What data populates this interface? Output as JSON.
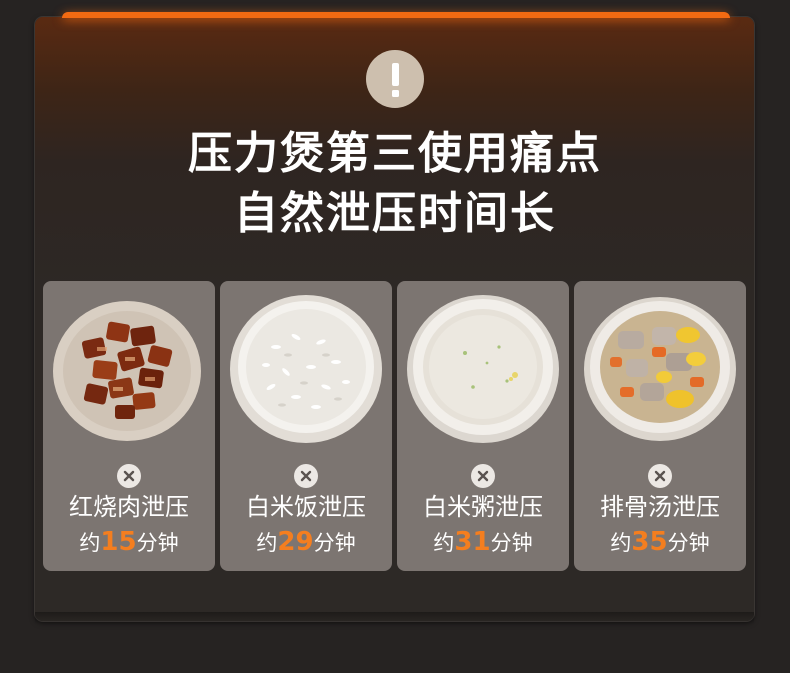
{
  "title": {
    "line1": "压力煲第三使用痛点",
    "line2": "自然泄压时间长"
  },
  "icons": {
    "header": "warning-icon",
    "card_badge": "close-icon"
  },
  "colors": {
    "accent": "#f26a12",
    "highlight_number": "#f47e1f",
    "card_bg": "#7c7571",
    "warning_circle": "#cdbfae"
  },
  "cards": [
    {
      "name": "红烧肉泄压",
      "prefix": "约",
      "minutes": "15",
      "suffix": "分钟"
    },
    {
      "name": "白米饭泄压",
      "prefix": "约",
      "minutes": "29",
      "suffix": "分钟"
    },
    {
      "name": "白米粥泄压",
      "prefix": "约",
      "minutes": "31",
      "suffix": "分钟"
    },
    {
      "name": "排骨汤泄压",
      "prefix": "约",
      "minutes": "35",
      "suffix": "分钟"
    }
  ]
}
